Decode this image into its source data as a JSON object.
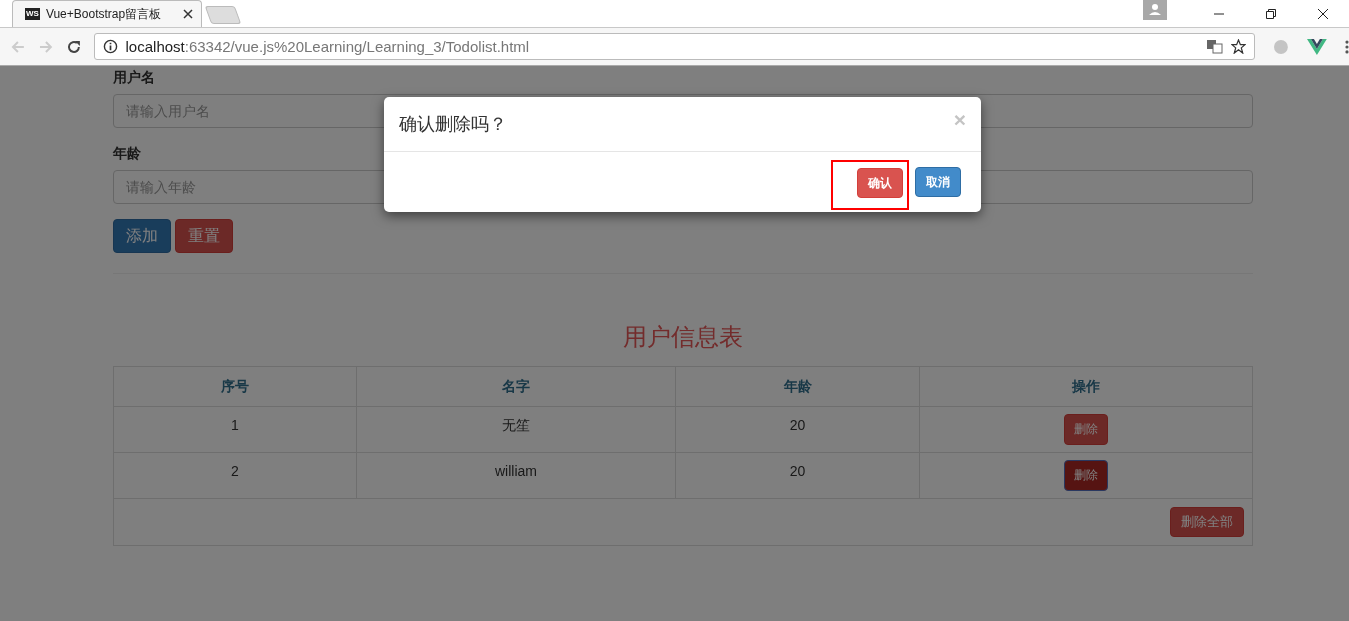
{
  "browser": {
    "tabs": [
      {
        "favicon": "WS",
        "title": "Vue+Bootstrap留言板",
        "selected": true
      }
    ],
    "address": {
      "host": "localhost",
      "path": ":63342/vue.js%20Learning/Learning_3/Todolist.html"
    }
  },
  "form": {
    "fields": [
      {
        "label": "用户名",
        "placeholder": "请输入用户名"
      },
      {
        "label": "年龄",
        "placeholder": "请输入年龄"
      }
    ],
    "buttons": [
      {
        "label": "添加",
        "kind": "primary"
      },
      {
        "label": "重置",
        "kind": "danger"
      }
    ]
  },
  "table": {
    "title": "用户信息表",
    "columns": [
      "序号",
      "名字",
      "年龄",
      "操作"
    ],
    "rows": [
      {
        "index": "1",
        "name": "无笙",
        "age": "20",
        "action": "删除",
        "focused": false
      },
      {
        "index": "2",
        "name": "william",
        "age": "20",
        "action": "删除",
        "focused": true
      }
    ],
    "footer_button": "删除全部"
  },
  "modal": {
    "title": "确认删除吗？",
    "close": "×",
    "buttons": [
      {
        "label": "确认",
        "kind": "danger",
        "highlighted": true
      },
      {
        "label": "取消",
        "kind": "primary",
        "highlighted": false
      }
    ]
  }
}
